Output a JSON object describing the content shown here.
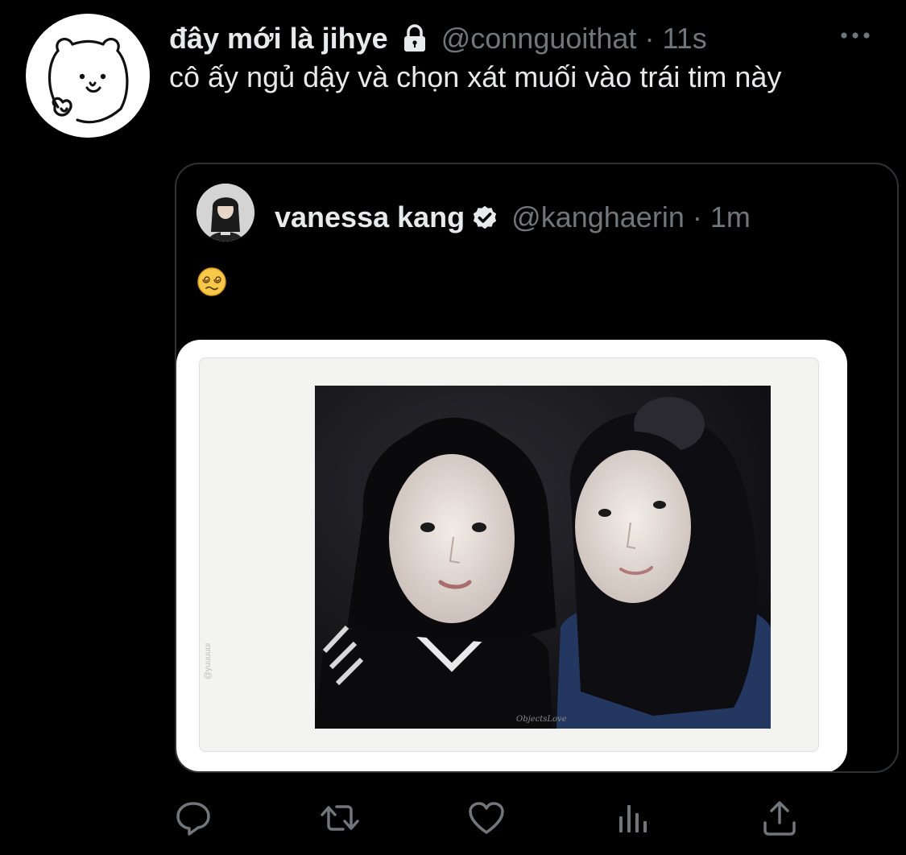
{
  "tweet": {
    "display_name": "đây mới là jihye",
    "handle": "@connguoithat",
    "separator": "·",
    "time": "11s",
    "text": "cô ấy ngủ dậy và chọn xát muối vào trái tim này",
    "icons": {
      "lock": "lock-icon",
      "more": "more-horizontal-icon"
    }
  },
  "quoted_tweet": {
    "display_name": "vanessa kang",
    "handle": "@kanghaerin",
    "separator": "·",
    "time": "1m",
    "emoji": "face-with-spiral-eyes",
    "photo_watermark": "ObjectsLove",
    "side_watermark": "@yuuuuui",
    "icons": {
      "verified": "verified-badge-icon"
    }
  },
  "actions": [
    {
      "name": "reply",
      "icon": "reply-icon"
    },
    {
      "name": "retweet",
      "icon": "retweet-icon"
    },
    {
      "name": "like",
      "icon": "heart-icon"
    },
    {
      "name": "analytics",
      "icon": "analytics-icon"
    },
    {
      "name": "share",
      "icon": "share-icon"
    }
  ],
  "colors": {
    "background": "#000000",
    "text_primary": "#e7e9ea",
    "text_secondary": "#71767b",
    "border": "#2f3336"
  }
}
